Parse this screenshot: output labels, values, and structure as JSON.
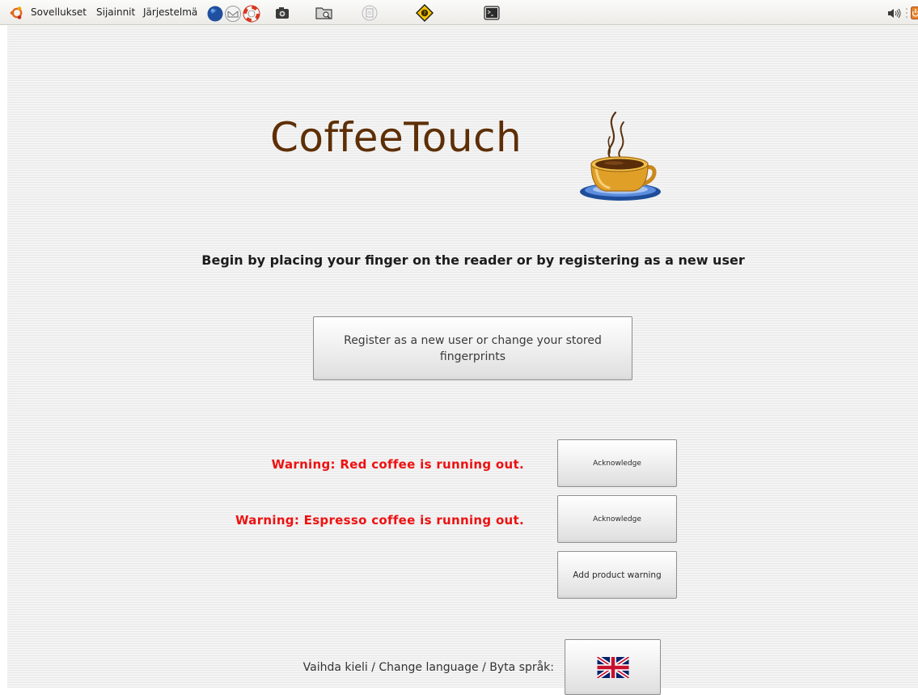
{
  "panel": {
    "menus": [
      {
        "label": "Sovellukset"
      },
      {
        "label": "Sijainnit"
      },
      {
        "label": "Järjestelmä"
      }
    ],
    "launchers": [
      "web-browser-icon",
      "mail-icon",
      "help-icon",
      "screenshot-icon",
      "file-manager-icon",
      "text-editor-icon",
      "update-notifier-icon",
      "terminal-icon"
    ],
    "tray": [
      "volume-icon",
      "power-icon"
    ]
  },
  "app": {
    "logo_text": "CoffeeTouch",
    "logo_icon": "coffee-cup-icon",
    "instruction": "Begin by placing your finger on the reader or by registering as a new user",
    "register_button": "Register as a new user or change your stored fingerprints",
    "warnings": [
      {
        "text": "Warning: Red coffee is running out.",
        "button": "Acknowledge"
      },
      {
        "text": "Warning: Espresso coffee is running out.",
        "button": "Acknowledge"
      }
    ],
    "add_warning_button": "Add product warning",
    "language_label": "Vaihda kieli / Change language / Byta språk:",
    "language_icon": "uk-flag-icon",
    "colors": {
      "logo": "#5e2f07",
      "warning": "#ee1111",
      "ubuntu": "#e2661f"
    }
  }
}
